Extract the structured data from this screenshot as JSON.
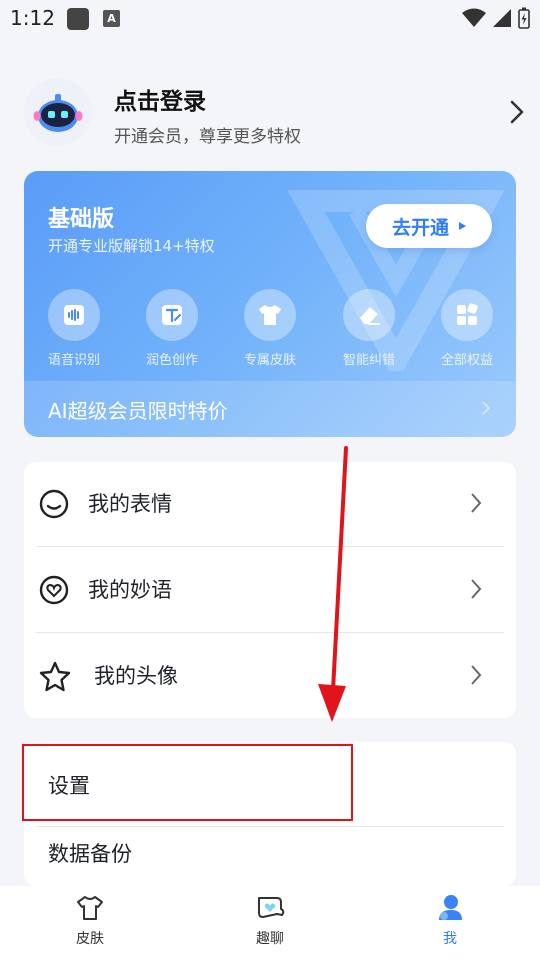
{
  "status_bar": {
    "time": "1:12",
    "notification_icon": "square-icon",
    "a_icon_letter": "A"
  },
  "profile": {
    "title": "点击登录",
    "subtitle": "开通会员，尊享更多特权"
  },
  "vip": {
    "title": "基础版",
    "subtitle": "开通专业版解锁14+特权",
    "open_button": "去开通",
    "perks": [
      {
        "label": "语音识别",
        "icon": "voice-icon"
      },
      {
        "label": "润色创作",
        "icon": "edit-text-icon"
      },
      {
        "label": "专属皮肤",
        "icon": "tshirt-icon"
      },
      {
        "label": "智能纠错",
        "icon": "eraser-icon"
      },
      {
        "label": "全部权益",
        "icon": "grid-icon"
      }
    ],
    "promo": "AI超级会员限时特价"
  },
  "my_list": [
    {
      "label": "我的表情",
      "icon": "smile-icon"
    },
    {
      "label": "我的妙语",
      "icon": "heart-bubble-icon"
    },
    {
      "label": "我的头像",
      "icon": "star-icon"
    }
  ],
  "settings_list": [
    {
      "label": "设置"
    },
    {
      "label": "数据备份"
    }
  ],
  "annotation": {
    "arrow_color": "#e0141a",
    "highlight_color": "#e0141a"
  },
  "bottom_nav": [
    {
      "label": "皮肤",
      "icon": "tshirt-icon",
      "active": false
    },
    {
      "label": "趣聊",
      "icon": "chat-heart-icon",
      "active": false
    },
    {
      "label": "我",
      "icon": "person-icon",
      "active": true
    }
  ],
  "colors": {
    "accent": "#2f7ff2",
    "vip_gradient_start": "#5a9cf8",
    "vip_gradient_end": "#9ccafc"
  }
}
